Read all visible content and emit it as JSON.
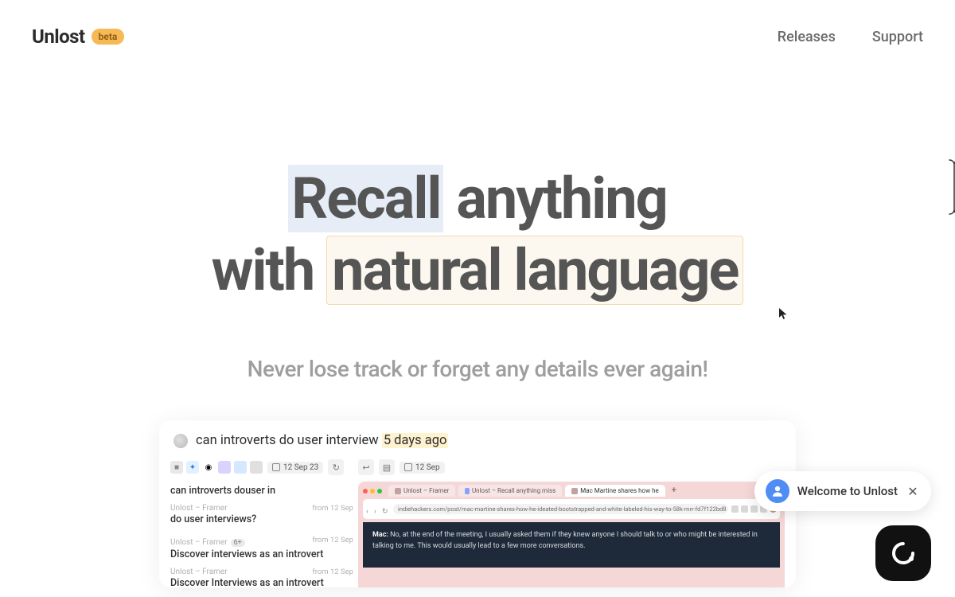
{
  "brand": {
    "name": "Unlost",
    "badge": "beta"
  },
  "nav": {
    "releases": "Releases",
    "support": "Support"
  },
  "hero": {
    "word_recall": "Recall",
    "word_anything": " anything",
    "word_with": "with ",
    "word_natural_language": "natural language"
  },
  "subhead": "Never lose track or forget any details ever again!",
  "search": {
    "query_prefix": "can introverts do user interview ",
    "query_time": "5 days ago"
  },
  "toolbar": {
    "date_left": "12 Sep 23",
    "date_right": "12 Sep"
  },
  "results": [
    {
      "source": "",
      "date": "",
      "title": "can introverts douser in"
    },
    {
      "source": "Unlost – Framer",
      "date": "from 12 Sep",
      "title": "do user interviews?"
    },
    {
      "source": "Unlost – Framer",
      "badge": "6+",
      "date": "from 12 Sep",
      "title": "Discover interviews as an introvert"
    },
    {
      "source": "Unlost – Framer",
      "date": "from 12 Sep",
      "title": "Discover Interviews as an introvert"
    }
  ],
  "browser": {
    "tabs": [
      {
        "label": "Unlost – Framer"
      },
      {
        "label": "Unlost – Recall anything miss"
      },
      {
        "label": "Mac Martine shares how he",
        "active": true
      }
    ],
    "url": "indiehackers.com/post/mac-martine-shares-how-he-ideated-bootstrapped-and-white-labeled-his-way-to-58k-mrr-fd7f122bd8",
    "speaker": "Mac:",
    "body": "No, at the end of the meeting, I usually asked them if they knew anyone I should talk to or who might be interested in talking to me. This would usually lead to a few more conversations."
  },
  "chat": {
    "welcome": "Welcome to Unlost"
  }
}
